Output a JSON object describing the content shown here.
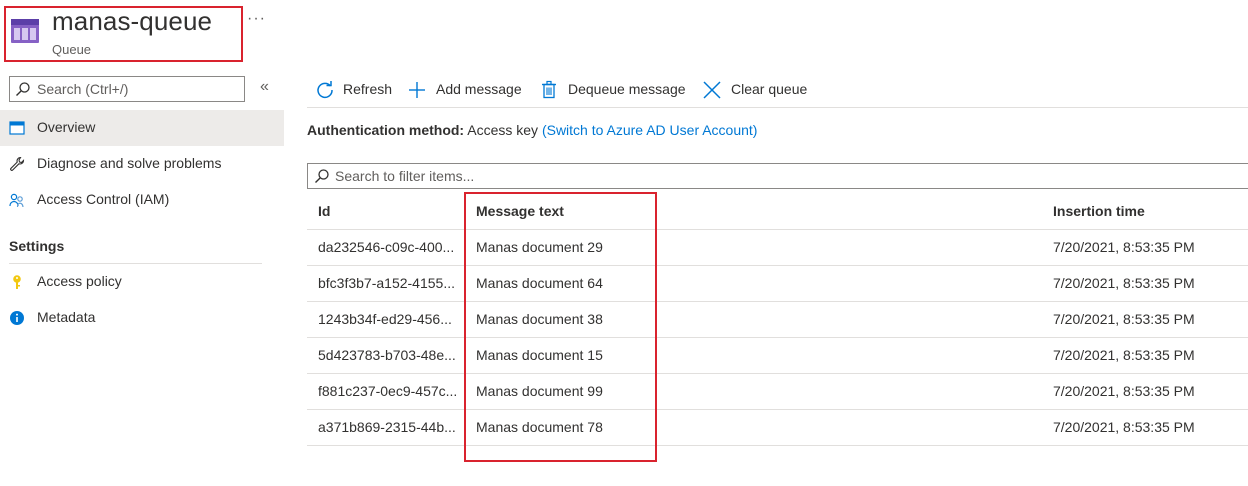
{
  "header": {
    "title": "manas-queue",
    "subtitle": "Queue",
    "more": "···"
  },
  "sidebar": {
    "search_placeholder": "Search (Ctrl+/)",
    "collapse": "«",
    "items": [
      {
        "label": "Overview",
        "icon": "overview-icon"
      },
      {
        "label": "Diagnose and solve problems",
        "icon": "wrench-icon"
      },
      {
        "label": "Access Control (IAM)",
        "icon": "people-icon"
      }
    ],
    "section": "Settings",
    "settings_items": [
      {
        "label": "Access policy",
        "icon": "key-icon"
      },
      {
        "label": "Metadata",
        "icon": "info-icon"
      }
    ]
  },
  "toolbar": {
    "refresh": "Refresh",
    "add": "Add message",
    "dequeue": "Dequeue message",
    "clear": "Clear queue"
  },
  "auth": {
    "label": "Authentication method:",
    "value": "Access key",
    "link": "(Switch to Azure AD User Account)"
  },
  "filter": {
    "placeholder": "Search to filter items..."
  },
  "table": {
    "columns": [
      "Id",
      "Message text",
      "Insertion time"
    ],
    "rows": [
      {
        "id": "da232546-c09c-400...",
        "text": "Manas document 29",
        "time": "7/20/2021, 8:53:35 PM"
      },
      {
        "id": "bfc3f3b7-a152-4155...",
        "text": "Manas document 64",
        "time": "7/20/2021, 8:53:35 PM"
      },
      {
        "id": "1243b34f-ed29-456...",
        "text": "Manas document 38",
        "time": "7/20/2021, 8:53:35 PM"
      },
      {
        "id": "5d423783-b703-48e...",
        "text": "Manas document 15",
        "time": "7/20/2021, 8:53:35 PM"
      },
      {
        "id": "f881c237-0ec9-457c...",
        "text": "Manas document 99",
        "time": "7/20/2021, 8:53:35 PM"
      },
      {
        "id": "a371b869-2315-44b...",
        "text": "Manas document 78",
        "time": "7/20/2021, 8:53:35 PM"
      }
    ]
  },
  "colors": {
    "accent": "#0078d4",
    "highlight": "#d9232e",
    "queue_icon": "#8661c5"
  }
}
